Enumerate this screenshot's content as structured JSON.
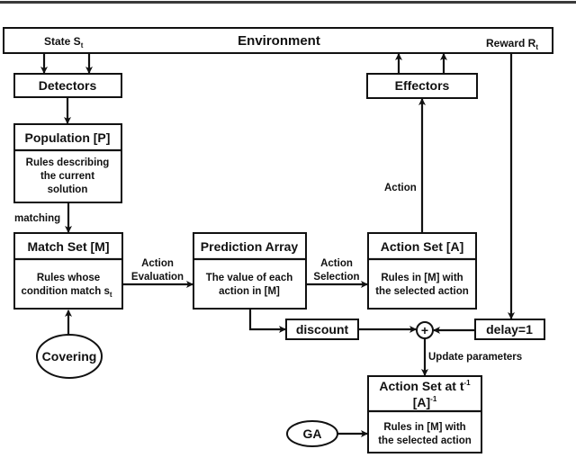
{
  "environment": {
    "title": "Environment",
    "state_label": "State S",
    "state_sub": "t",
    "reward_label": "Reward R",
    "reward_sub": "t"
  },
  "detectors": {
    "title": "Detectors"
  },
  "effectors": {
    "title": "Effectors"
  },
  "population": {
    "title": "Population [P]",
    "body": [
      "Rules describing",
      "the current",
      "solution"
    ]
  },
  "match_set": {
    "title": "Match Set [M]",
    "body_line1": "Rules whose",
    "body_line2": "condition match s",
    "body_line2_sub": "t"
  },
  "prediction_array": {
    "title": "Prediction Array",
    "body": [
      "The value of each",
      "action in [M]"
    ]
  },
  "action_set": {
    "title": "Action Set [A]",
    "body": [
      "Rules in [M] with",
      "the selected action"
    ]
  },
  "prev_action_set": {
    "title_line1": "Action Set at t",
    "title_line1_sup": "-1",
    "title_line2": "[A]",
    "title_line2_sup": "-1",
    "body": [
      "Rules in [M] with",
      "the selected action"
    ]
  },
  "discount": {
    "label": "discount"
  },
  "delay": {
    "label": "delay=1"
  },
  "sum_node": {
    "symbol": "+"
  },
  "covering": {
    "label": "Covering"
  },
  "ga": {
    "label": "GA"
  },
  "edge_labels": {
    "matching": "matching",
    "action_evaluation": [
      "Action",
      "Evaluation"
    ],
    "action_selection": [
      "Action",
      "Selection"
    ],
    "action": "Action",
    "update_parameters": "Update parameters"
  }
}
